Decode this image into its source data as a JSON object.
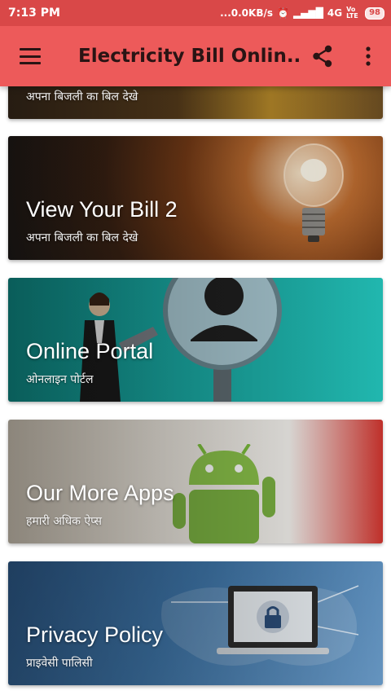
{
  "status_bar": {
    "time": "7:13 PM",
    "network_speed": "...0.0KB/s",
    "network_type": "4G",
    "volte": "Vo LTE",
    "battery": "98"
  },
  "app_bar": {
    "title": "Electricity Bill Onlin...",
    "menu_icon": "hamburger-menu-icon",
    "share_icon": "share-icon",
    "overflow_icon": "more-vert-icon"
  },
  "cards": [
    {
      "title": "",
      "subtitle": "अपना बिजली का बिल देखे"
    },
    {
      "title": "View Your Bill 2",
      "subtitle": "अपना बिजली का बिल देखे"
    },
    {
      "title": "Online Portal",
      "subtitle": "ओनलाइन पोर्टल"
    },
    {
      "title": "Our More Apps",
      "subtitle": "हमारी अधिक ऐप्स"
    },
    {
      "title": "Privacy Policy",
      "subtitle": "प्राइवेसी पालिसी"
    }
  ],
  "colors": {
    "status_bar": "#d94848",
    "app_bar": "#ed5a5a",
    "title_text": "#2a1414"
  }
}
